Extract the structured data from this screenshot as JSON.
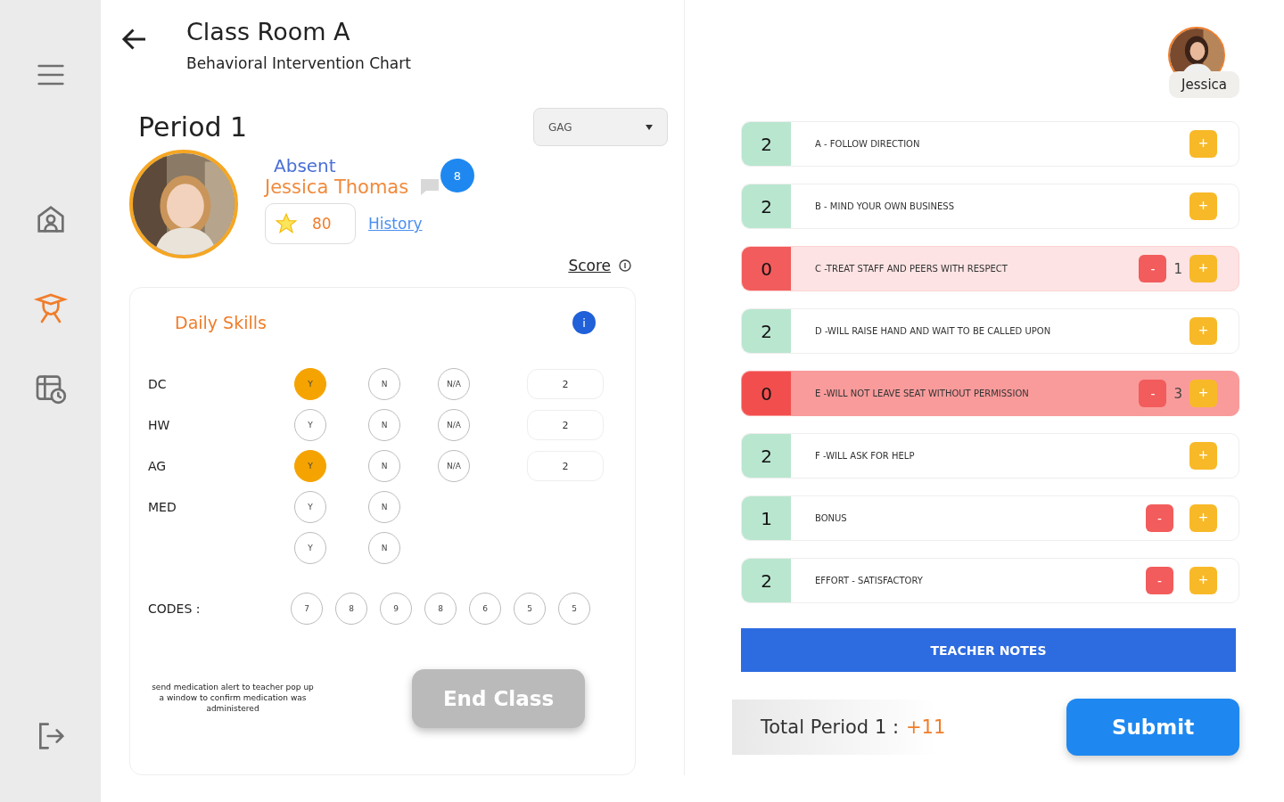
{
  "sidebar": {
    "items": [
      {
        "kind": "menu",
        "selected": false
      },
      {
        "kind": "school",
        "selected": false
      },
      {
        "kind": "teacher",
        "selected": true
      },
      {
        "kind": "schedule",
        "selected": false
      },
      {
        "kind": "logout",
        "selected": false
      }
    ]
  },
  "header": {
    "title": "Class Room A",
    "subtitle": "Behavioral Intervention Chart"
  },
  "period": {
    "title": "Period 1",
    "dropdown": "GAG"
  },
  "student": {
    "status": "Absent",
    "name": "Jessica Thomas",
    "badge": "8",
    "points": "80",
    "history": "History",
    "score_link": "Score"
  },
  "skills": {
    "title": "Daily Skills",
    "info": "i",
    "rows": [
      {
        "label": "DC",
        "options": [
          {
            "text": "Y",
            "selected": true
          },
          {
            "text": "N",
            "selected": false
          },
          {
            "text": "N/A",
            "selected": false
          }
        ],
        "value": "2"
      },
      {
        "label": "HW",
        "options": [
          {
            "text": "Y",
            "selected": false
          },
          {
            "text": "N",
            "selected": false
          },
          {
            "text": "N/A",
            "selected": false
          }
        ],
        "value": "2"
      },
      {
        "label": "AG",
        "options": [
          {
            "text": "Y",
            "selected": true
          },
          {
            "text": "N",
            "selected": false
          },
          {
            "text": "N/A",
            "selected": false
          }
        ],
        "value": "2"
      },
      {
        "label": "MED",
        "options": [
          {
            "text": "Y",
            "selected": false
          },
          {
            "text": "N",
            "selected": false
          }
        ]
      },
      {
        "options": [
          {
            "text": "Y",
            "selected": false
          },
          {
            "text": "N",
            "selected": false
          }
        ]
      }
    ],
    "codes_label": "CODES :",
    "codes": [
      "7",
      "8",
      "9",
      "8",
      "6",
      "5",
      "5"
    ],
    "note": "send medication alert to teacher pop up a window to confirm medication was administered",
    "end_button": "End Class"
  },
  "teacher": {
    "name": "Jessica"
  },
  "behaviors": [
    {
      "score": "2",
      "label": "A - FOLLOW DIRECTION",
      "kind": "ok",
      "minus": false
    },
    {
      "score": "2",
      "label": "B - MIND YOUR OWN BUSINESS",
      "kind": "ok",
      "minus": false
    },
    {
      "score": "0",
      "label": "C -TREAT STAFF AND PEERS WITH RESPECT",
      "kind": "warn",
      "minus": true,
      "count": "1"
    },
    {
      "score": "2",
      "label": "D -WILL RAISE HAND AND WAIT TO BE CALLED UPON",
      "kind": "ok",
      "minus": false
    },
    {
      "score": "0",
      "label": "E -WILL NOT LEAVE SEAT WITHOUT PERMISSION",
      "kind": "alert",
      "minus": true,
      "count": "3"
    },
    {
      "score": "2",
      "label": "F -WILL ASK FOR HELP",
      "kind": "ok",
      "minus": false
    },
    {
      "score": "1",
      "label": "BONUS",
      "kind": "ok",
      "minus": true
    },
    {
      "score": "2",
      "label": "EFFORT - SATISFACTORY",
      "kind": "ok",
      "minus": true
    }
  ],
  "plus_label": "+",
  "minus_label": "-",
  "notes_button": "TEACHER NOTES",
  "total": {
    "label": "Total Period 1 :",
    "value": "+11"
  },
  "submit": "Submit"
}
